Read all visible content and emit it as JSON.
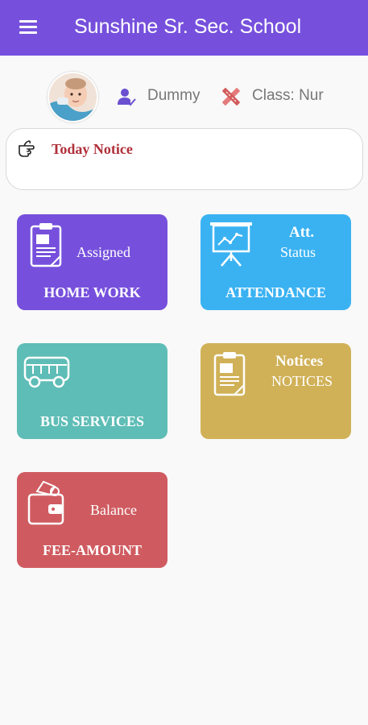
{
  "header": {
    "title": "Sunshine Sr. Sec. School",
    "menu_icon": "hamburger-menu-icon",
    "background_color": "#7650dc"
  },
  "profile": {
    "avatar_icon": "student-photo-avatar",
    "name_icon": "user-check-icon",
    "name": "Dummy",
    "class_icon": "pencil-ruler-icon",
    "class_label": "Class: Nur"
  },
  "notice": {
    "icon": "pointing-hand-icon",
    "title": "Today Notice",
    "title_color": "#b0303a"
  },
  "tiles": [
    {
      "id": "homework",
      "top_bold": "",
      "subtitle": "Assigned",
      "label": "HOME WORK",
      "icon": "clipboard-document-icon",
      "color": "#7650dc"
    },
    {
      "id": "attendance",
      "top_bold": "Att.",
      "subtitle": "Status",
      "label": "ATTENDANCE",
      "icon": "presentation-chart-icon",
      "color": "#3ab2f2"
    },
    {
      "id": "bus",
      "top_bold": "",
      "subtitle": "",
      "label": "BUS SERVICES",
      "icon": "bus-icon",
      "color": "#5ebdb6"
    },
    {
      "id": "notices",
      "top_bold": "Notices",
      "subtitle": "NOTICES",
      "label": "",
      "icon": "clipboard-document-icon",
      "color": "#d0b157"
    },
    {
      "id": "fee",
      "top_bold": "",
      "subtitle": "Balance",
      "label": "FEE-AMOUNT",
      "icon": "wallet-icon",
      "color": "#cf5b60"
    }
  ]
}
